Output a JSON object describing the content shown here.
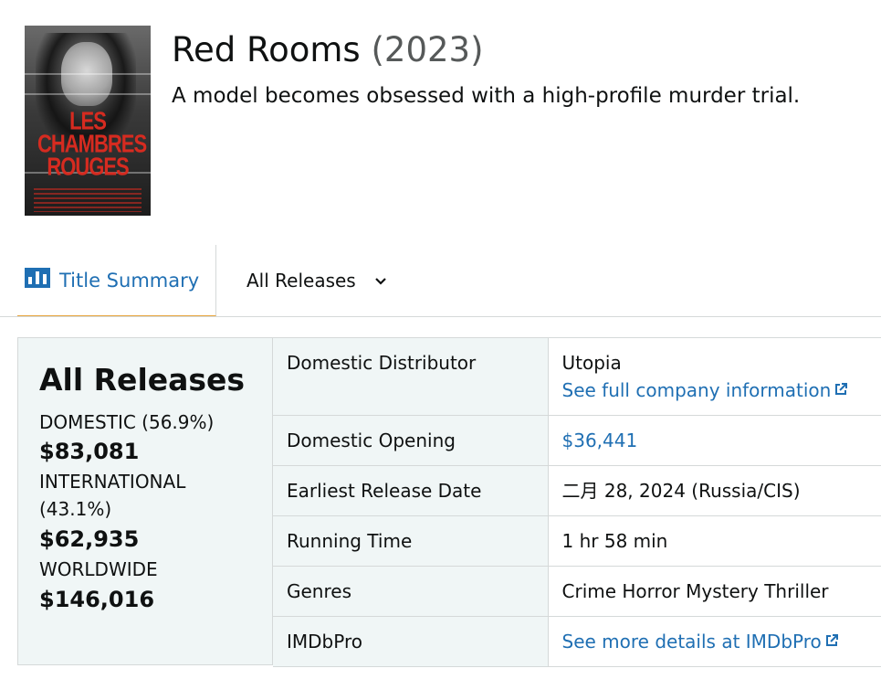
{
  "movie": {
    "title": "Red Rooms",
    "year": "(2023)",
    "tagline": "A model becomes obsessed with a high-profile murder trial.",
    "poster_title": "LES CHAMBRES ROUGES"
  },
  "tabs": {
    "summary_label": "Title Summary",
    "releases_label": "All Releases"
  },
  "summary": {
    "heading": "All Releases",
    "domestic_label": "DOMESTIC (56.9%)",
    "domestic_value": "$83,081",
    "international_label": "INTERNATIONAL (43.1%)",
    "international_value": "$62,935",
    "worldwide_label": "WORLDWIDE",
    "worldwide_value": "$146,016"
  },
  "details": {
    "distributor_label": "Domestic Distributor",
    "distributor_value": "Utopia",
    "distributor_link": "See full company information",
    "opening_label": "Domestic Opening",
    "opening_value": "$36,441",
    "release_label": "Earliest Release Date",
    "release_value": "二月 28, 2024 (Russia/CIS)",
    "running_label": "Running Time",
    "running_value": "1 hr 58 min",
    "genres_label": "Genres",
    "genres_value": "Crime Horror Mystery Thriller",
    "imdb_label": "IMDbPro",
    "imdb_link": "See more details at IMDbPro"
  },
  "colors": {
    "link": "#1f6fb3",
    "panel": "#f0f6f6",
    "tab_underline": "#e8a53e",
    "poster_title": "#d62b20"
  },
  "icons": [
    "bar-chart-icon",
    "chevron-down-icon",
    "external-link-icon"
  ]
}
